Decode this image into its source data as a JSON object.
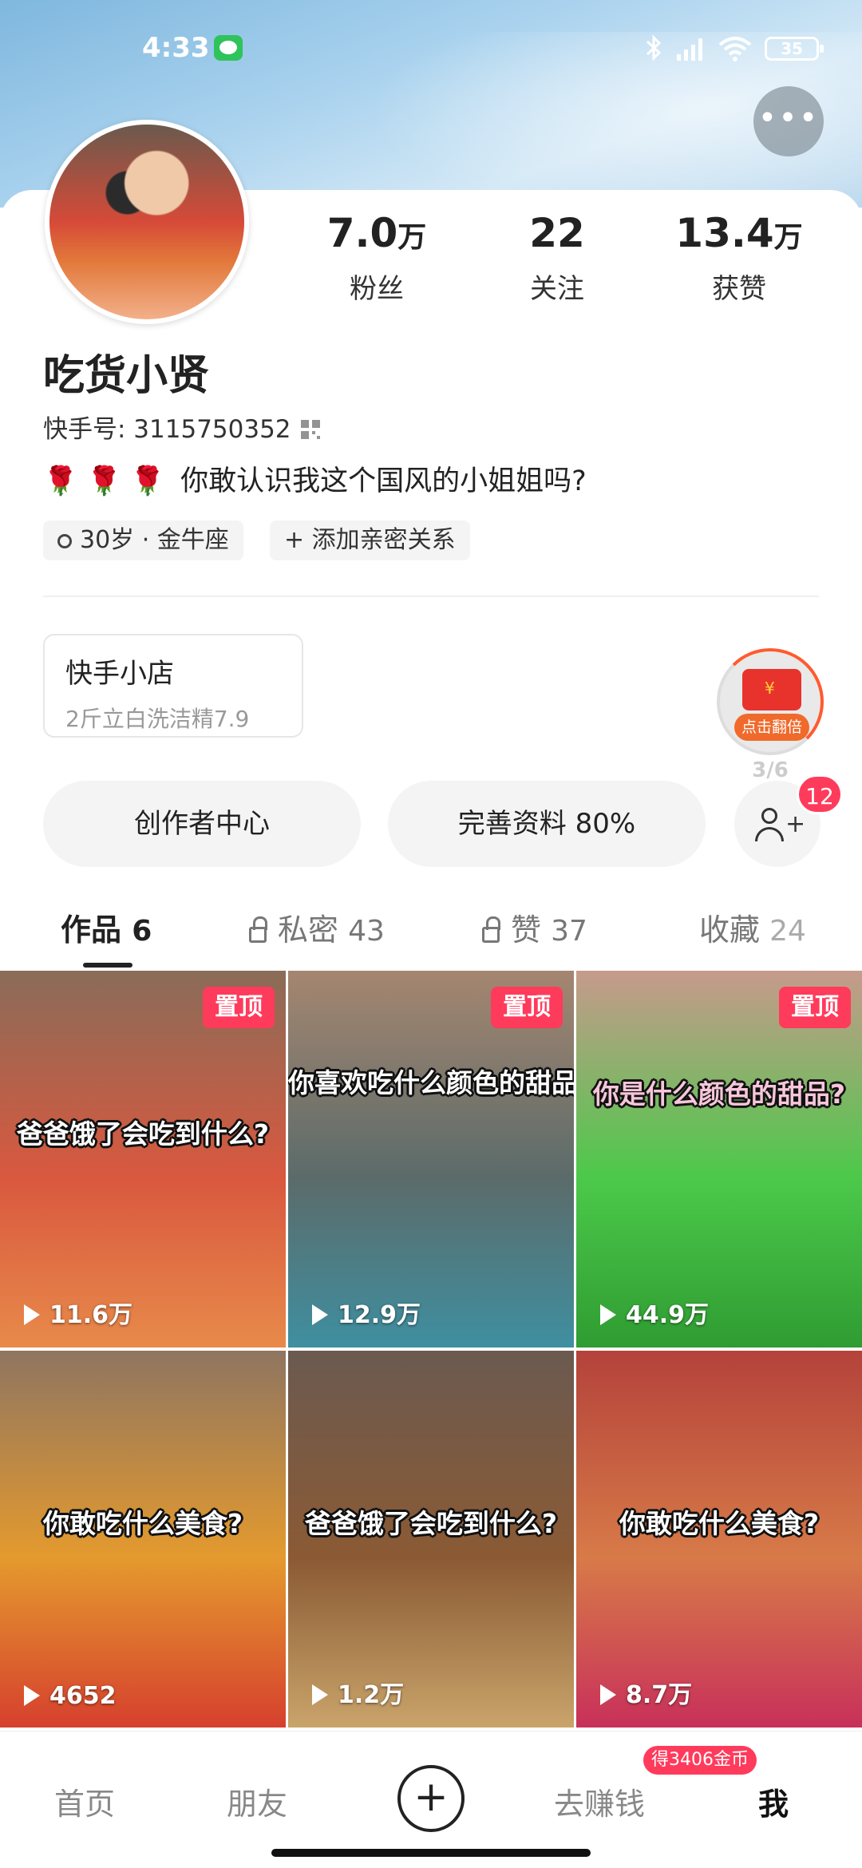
{
  "status_bar": {
    "time": "4:33",
    "battery": "35"
  },
  "profile": {
    "username": "吃货小贤",
    "account_id": "快手号: 3115750352",
    "bio": "你敢认识我这个国风的小姐姐吗?",
    "bio_emoji": "🌹 🌹 🌹",
    "tags": [
      "30岁 · 金牛座",
      "+ 添加亲密关系"
    ]
  },
  "stats": [
    {
      "value": "7.0",
      "unit": "万",
      "label": "粉丝"
    },
    {
      "value": "22",
      "unit": "",
      "label": "关注"
    },
    {
      "value": "13.4",
      "unit": "万",
      "label": "获赞"
    }
  ],
  "shop": {
    "title": "快手小店",
    "subtitle": "2斤立白洗洁精7.9"
  },
  "red_packet": {
    "label": "点击翻倍",
    "count": "3/6"
  },
  "actions": {
    "creator_center": "创作者中心",
    "complete_profile": "完善资料 80%",
    "friend_badge": "12"
  },
  "tabs": [
    {
      "label": "作品",
      "count": "6"
    },
    {
      "label": "私密",
      "count": "43"
    },
    {
      "label": "赞",
      "count": "37"
    },
    {
      "label": "收藏",
      "count": "24"
    }
  ],
  "videos": [
    {
      "caption": "爸爸饿了会吃到什么?",
      "views": "11.6万",
      "pinned": "置顶",
      "colors": [
        "#8a6c58",
        "#d9583f",
        "#e88a4a"
      ]
    },
    {
      "caption": "你喜欢吃什么颜色的甜品?",
      "views": "12.9万",
      "pinned": "置顶",
      "colors": [
        "#a58670",
        "#5b6b6a",
        "#3f8fa0"
      ]
    },
    {
      "caption": "你是什么颜色的甜品?",
      "views": "44.9万",
      "pinned": "置顶",
      "colors": [
        "#c79a8c",
        "#4cc94a",
        "#2f9c32"
      ]
    },
    {
      "caption": "你敢吃什么美食?",
      "views": "4652",
      "pinned": "",
      "colors": [
        "#8f7560",
        "#e49a2e",
        "#d6402e"
      ]
    },
    {
      "caption": "爸爸饿了会吃到什么?",
      "views": "1.2万",
      "pinned": "",
      "colors": [
        "#6b5a50",
        "#8b5a34",
        "#c9a46a"
      ]
    },
    {
      "caption": "你敢吃什么美食?",
      "views": "8.7万",
      "pinned": "",
      "colors": [
        "#b4423b",
        "#d77a48",
        "#c8305a"
      ]
    }
  ],
  "bottom_nav": {
    "home": "首页",
    "friends": "朋友",
    "create": "+",
    "earn": "去赚钱",
    "coin_badge": "得3406金币",
    "me": "我"
  }
}
